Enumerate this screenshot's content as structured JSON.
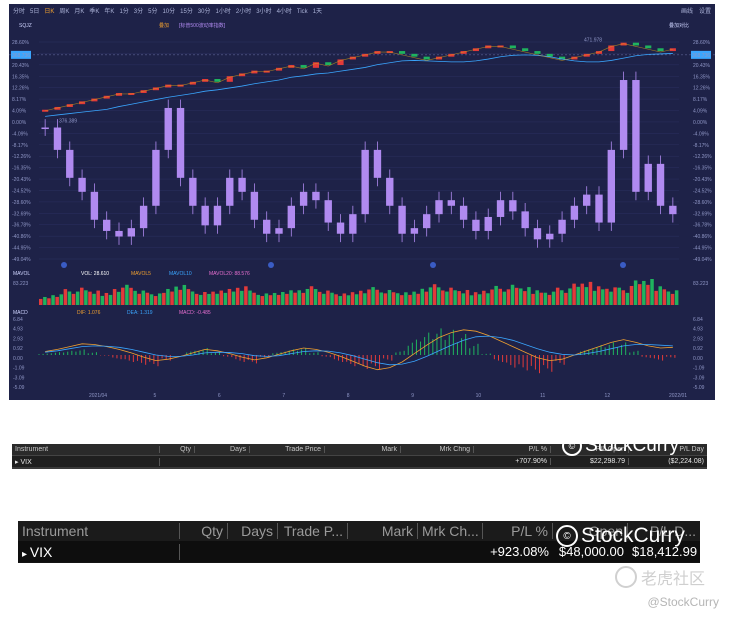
{
  "toolbar": {
    "items": [
      "分时",
      "5日",
      "日K",
      "周K",
      "月K",
      "季K",
      "年K",
      "1分",
      "3分",
      "5分",
      "10分",
      "15分",
      "30分",
      "1小时",
      "2小时",
      "3小时",
      "4小时",
      "Tick",
      "1天"
    ],
    "active_item": "日K",
    "right_items": [
      "画线",
      "设置"
    ],
    "symbol": "SQJZ",
    "center_title": "叠加",
    "center_subtitle": "[标普500波动率指数]",
    "right_mode": "叠加对比"
  },
  "indicators": {
    "mavol_name": "MAVOL",
    "vol_label": "VOL: 28.610",
    "mavol5_label": "MAVOL5",
    "mavol10_label": "MAVOL10",
    "mavol20_label": "MAVOL20: 88.576",
    "vol_axis_value": "83.223",
    "macd_name": "MACD",
    "dif_label": "DIF: 1.076",
    "dea_label": "DEA: 1.319",
    "macd_label": "MACD: -0.485"
  },
  "annotations": {
    "low": "376.389",
    "high": "471.978"
  },
  "colors": {
    "background": "#1e2248",
    "up": "#e23a3a",
    "down": "#1fb35e",
    "vix_candle": "#b08af0",
    "spx_line": "#d4a017",
    "ma_line": "#3aa6ff",
    "price_marker": "#3aa6ff"
  },
  "chart_data": {
    "type": "candlestick",
    "x_labels": [
      "2021/04",
      "5",
      "6",
      "7",
      "8",
      "9",
      "10",
      "11",
      "12",
      "2022/01"
    ],
    "y_axis_left": [
      "28.60%",
      "24.52%",
      "20.43%",
      "16.35%",
      "12.26%",
      "8.17%",
      "4.09%",
      "0.00%",
      "-4.09%",
      "-8.17%",
      "-12.26%",
      "-16.35%",
      "-20.43%",
      "-24.52%",
      "-28.60%",
      "-32.69%",
      "-36.78%",
      "-40.86%",
      "-44.95%",
      "-49.04%"
    ],
    "y_axis_right": [
      "28.60%",
      "24.52%",
      "20.43%",
      "16.35%",
      "12.26%",
      "8.17%",
      "4.09%",
      "0.00%",
      "-4.09%",
      "-8.17%",
      "-12.26%",
      "-16.35%",
      "-20.43%",
      "-24.52%",
      "-28.60%",
      "-32.69%",
      "-36.78%",
      "-40.86%",
      "-44.95%",
      "-49.04%"
    ],
    "ylim": [
      -49.04,
      28.6
    ],
    "current_left": "368.736",
    "current_right": "368.736",
    "series": [
      {
        "name": "SPX",
        "values": [
          4,
          5,
          6,
          7,
          8,
          9,
          10,
          10,
          11,
          12,
          13,
          13,
          14,
          15,
          14,
          16,
          17,
          18,
          18,
          19,
          20,
          19,
          21,
          20,
          22,
          23,
          24,
          25,
          25,
          24,
          23,
          22,
          23,
          24,
          25,
          26,
          27,
          27,
          26,
          25,
          24,
          23,
          22,
          23,
          24,
          25,
          27,
          28,
          27,
          26,
          25,
          26
        ]
      },
      {
        "name": "VIX",
        "values": [
          -2,
          -10,
          -20,
          -25,
          -35,
          -39,
          -41,
          -38,
          -30,
          -10,
          5,
          -20,
          -30,
          -37,
          -30,
          -20,
          -25,
          -35,
          -40,
          -38,
          -30,
          -25,
          -28,
          -36,
          -40,
          -33,
          -10,
          -20,
          -30,
          -40,
          -38,
          -33,
          -28,
          -30,
          -35,
          -39,
          -34,
          -28,
          -32,
          -38,
          -42,
          -40,
          -35,
          -30,
          -26,
          -36,
          -10,
          15,
          -25,
          -15,
          -30,
          -33
        ]
      }
    ],
    "volume": [
      30,
      40,
      55,
      60,
      50,
      45,
      65,
      70,
      50,
      40,
      60,
      75,
      55,
      45,
      50,
      60,
      70,
      50,
      40,
      45,
      55,
      60,
      65,
      50,
      40,
      48,
      58,
      62,
      52,
      44,
      50,
      66,
      72,
      60,
      52,
      48,
      58,
      66,
      70,
      62,
      55,
      50,
      60,
      74,
      80,
      70,
      66,
      60,
      85,
      90,
      70,
      55
    ],
    "macd": {
      "dif": [
        0.5,
        0.8,
        1.2,
        1.6,
        1.5,
        1.2,
        0.8,
        0.3,
        -0.3,
        -0.8,
        -0.6,
        -0.2,
        0.3,
        0.8,
        0.6,
        0.2,
        -0.3,
        -0.7,
        -0.4,
        0.1,
        0.6,
        1.0,
        0.8,
        0.4,
        -0.2,
        -0.9,
        -1.6,
        -2.1,
        -1.8,
        -1.0,
        0.2,
        1.4,
        2.5,
        3.2,
        3.6,
        3.4,
        2.8,
        2.0,
        1.2,
        0.4,
        -0.4,
        -0.8,
        -0.6,
        0.0,
        0.6,
        1.2,
        1.8,
        2.2,
        1.8,
        1.3,
        1.0,
        1.1
      ],
      "dea": [
        0.4,
        0.6,
        0.9,
        1.2,
        1.3,
        1.25,
        1.1,
        0.8,
        0.4,
        0.0,
        -0.2,
        -0.2,
        0.0,
        0.3,
        0.4,
        0.35,
        0.2,
        -0.1,
        -0.2,
        -0.1,
        0.2,
        0.5,
        0.6,
        0.55,
        0.3,
        -0.1,
        -0.6,
        -1.1,
        -1.4,
        -1.3,
        -0.9,
        -0.2,
        0.6,
        1.4,
        2.1,
        2.6,
        2.7,
        2.5,
        2.1,
        1.5,
        0.9,
        0.4,
        0.1,
        0.0,
        0.2,
        0.5,
        0.9,
        1.3,
        1.5,
        1.5,
        1.4,
        1.3
      ]
    },
    "macd_axis": [
      "6.84",
      "4.93",
      "2.93",
      "0.92",
      "0.00",
      "-1.09",
      "-3.09",
      "-5.09"
    ]
  },
  "table_small": {
    "headers": [
      "Instrument",
      "Qty",
      "Days",
      "Trade Price",
      "Mark",
      "Mrk Chng",
      "P/L %",
      "P/L Open",
      "P/L Day"
    ],
    "row": {
      "instrument": "VIX",
      "qty": "",
      "days": "",
      "trade_price": "",
      "mark": "",
      "mrk_chng": "",
      "pl_pct": "+707.90%",
      "pl_open": "$22,298.79",
      "pl_day": "($2,224.08)"
    }
  },
  "table_large": {
    "headers": [
      "Instrument",
      "Qty",
      "Days",
      "Trade P...",
      "Mark",
      "Mrk Ch...",
      "P/L %",
      "Open",
      "P/L D..."
    ],
    "row": {
      "instrument": "VIX",
      "qty": "",
      "days": "",
      "trade_price": "",
      "mark": "",
      "mrk_chng": "",
      "pl_pct": "+923.08%",
      "pl_open": "$48,000.00",
      "pl_day": "$18,412.99"
    }
  },
  "watermarks": {
    "text": "StockCurry",
    "tiger_text": "老虎社区",
    "caption": "@StockCurry"
  }
}
